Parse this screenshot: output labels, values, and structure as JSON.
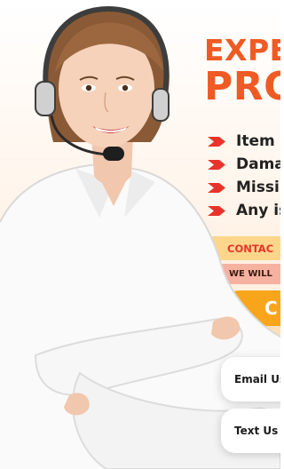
{
  "headline": {
    "line1": "EXPE",
    "line2": "PRO"
  },
  "issues": [
    {
      "label": "Item"
    },
    {
      "label": "Dama"
    },
    {
      "label": "Missi"
    },
    {
      "label": "Any is"
    }
  ],
  "bars": {
    "contact": "CONTAC",
    "will": "WE WILL",
    "call": "C"
  },
  "buttons": {
    "email": "Email Us",
    "text": "Text Us"
  },
  "colors": {
    "accent_orange": "#f05a24",
    "chevron_red": "#e8332c",
    "bar_yellow": "#fdd68b",
    "bar_pink": "#f6b2a0",
    "bar_orange": "#f8a51c"
  }
}
